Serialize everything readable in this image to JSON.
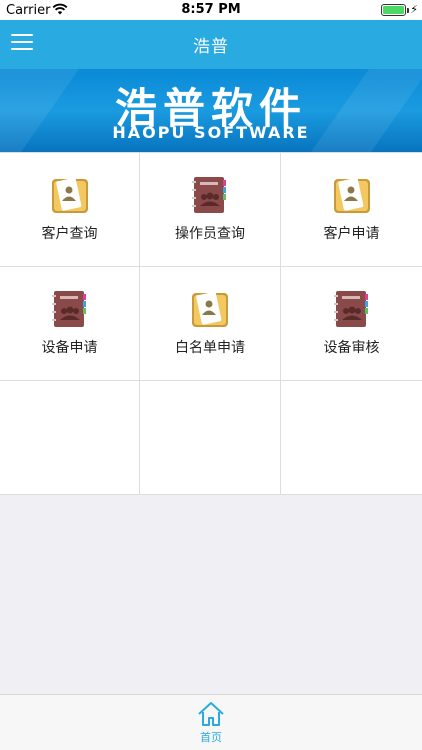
{
  "status_bar": {
    "carrier": "Carrier",
    "time": "8:57 PM",
    "battery_level": 1.0
  },
  "nav": {
    "title": "浩普",
    "menu_icon": "hamburger-menu-icon"
  },
  "banner": {
    "cn_text": "浩普软件",
    "en_text": "HAOPU SOFTWARE"
  },
  "grid": {
    "items": [
      {
        "label": "客户查询",
        "icon": "clipboard-user-icon"
      },
      {
        "label": "操作员查询",
        "icon": "employee-book-icon"
      },
      {
        "label": "客户申请",
        "icon": "clipboard-user-icon"
      },
      {
        "label": "设备申请",
        "icon": "employee-book-icon"
      },
      {
        "label": "白名单申请",
        "icon": "clipboard-user-icon"
      },
      {
        "label": "设备审核",
        "icon": "employee-book-icon"
      }
    ]
  },
  "tab_bar": {
    "home_label": "首页",
    "accent_color": "#29abe2"
  },
  "colors": {
    "nav_bg": "#29abe2",
    "page_bg": "#efeff4"
  }
}
